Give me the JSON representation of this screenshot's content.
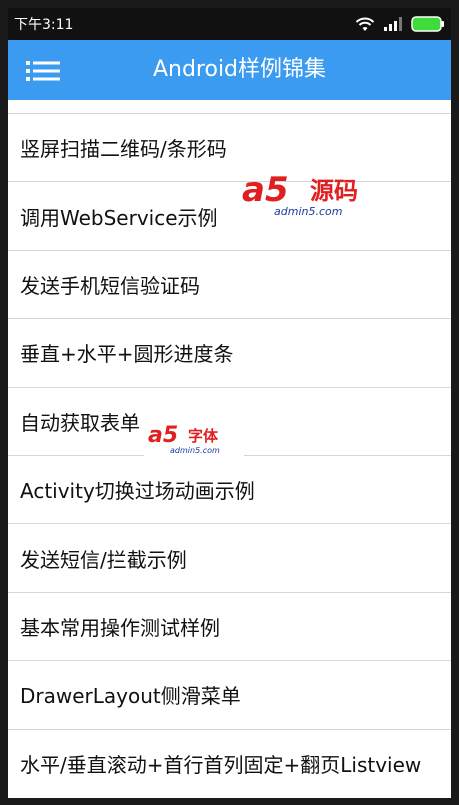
{
  "status_bar": {
    "time": "下午3:11",
    "icons": [
      "wifi-icon",
      "signal-icon",
      "battery-icon"
    ]
  },
  "title_bar": {
    "title": "Android样例锦集",
    "menu_icon": "menu-icon"
  },
  "list": {
    "items": [
      {
        "label": "竖屏扫描二维码/条形码"
      },
      {
        "label": "调用WebService示例"
      },
      {
        "label": "发送手机短信验证码"
      },
      {
        "label": "垂直+水平+圆形进度条"
      },
      {
        "label": "自动获取表单"
      },
      {
        "label": "Activity切换过场动画示例"
      },
      {
        "label": "发送短信/拦截示例"
      },
      {
        "label": "基本常用操作测试样例"
      },
      {
        "label": "DrawerLayout侧滑菜单"
      },
      {
        "label": "水平/垂直滚动+首行首列固定+翻页Listview"
      }
    ]
  },
  "watermarks": {
    "wm1_main": "a5",
    "wm1_cn": "源码",
    "wm1_url": "admin5.com",
    "wm2_main": "a5",
    "wm2_cn": "字体",
    "wm2_url": "admin5.com"
  },
  "colors": {
    "title_bar": "#3a9bf0",
    "status_bar": "#111111",
    "battery": "#3ddc3a",
    "watermark_red": "#e02020"
  }
}
